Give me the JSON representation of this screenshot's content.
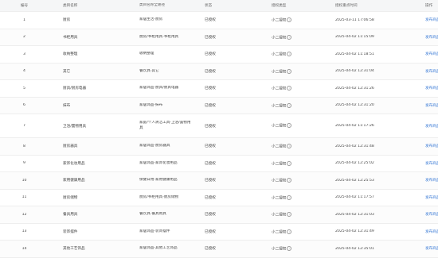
{
  "table": {
    "headers": {
      "no": "编号",
      "name": "类目名称",
      "path": "类目名称全路径",
      "status": "状态",
      "type": "授权类型",
      "time": "授权重点时间",
      "op": "操作"
    },
    "rows": [
      {
        "no": "1",
        "name": "厨房",
        "path": "家居生活-厨房",
        "status": "已授权",
        "type": "小二授权",
        "time": "2025-03-11 17:06:58",
        "op": "发布商品"
      },
      {
        "no": "2",
        "name": "书柜用具",
        "path": "厨房/书柜用具-书柜用具",
        "status": "已授权",
        "type": "小二授权",
        "time": "2025-04-02 11:15:09",
        "op": "发布商品"
      },
      {
        "no": "3",
        "name": "收纳整理",
        "path": "收纳整理",
        "status": "已授权",
        "type": "小二授权",
        "time": "2025-04-02 11:18:51",
        "op": "发布商品"
      },
      {
        "no": "4",
        "name": "其它",
        "path": "餐饮具-其它",
        "status": "已授权",
        "type": "小二授权",
        "time": "2025-04-02 12:31:04",
        "op": "发布商品"
      },
      {
        "no": "5",
        "name": "厨具/厨房电器",
        "path": "家居饰品-厨具/厨具电器",
        "status": "已授权",
        "type": "小二授权",
        "time": "2025-04-02 12:31:26",
        "op": "发布商品"
      },
      {
        "no": "6",
        "name": "抹布",
        "path": "家居饰品-抹布",
        "status": "已授权",
        "type": "小二授权",
        "time": "2025-04-02 12:31:20",
        "op": "发布商品"
      },
      {
        "no": "7",
        "name": "卫浴/置物用具",
        "path": "家庭/个人清洁工具-卫浴/置物用具",
        "status": "已授权",
        "type": "小二授权",
        "time": "2025-04-02 11:17:26",
        "op": "发布商品",
        "tall": true
      },
      {
        "no": "8",
        "name": "厨房器具",
        "path": "家居饰品-厨房器具",
        "status": "已授权",
        "type": "小二授权",
        "time": "2025-04-02 12:31:48",
        "op": "发布商品"
      },
      {
        "no": "9",
        "name": "家饰化妆用品",
        "path": "家居饰品-家饰化妆用品",
        "status": "已授权",
        "type": "小二授权",
        "time": "2025-04-02 12:25:02",
        "op": "发布商品"
      },
      {
        "no": "10",
        "name": "家用健康用品",
        "path": "保健日用-家用健康用品",
        "status": "已授权",
        "type": "小二授权",
        "time": "2025-04-02 12:25:53",
        "op": "发布商品"
      },
      {
        "no": "11",
        "name": "厨房储物",
        "path": "厨房/书柜用具-厨房储物",
        "status": "已授权",
        "type": "小二授权",
        "time": "2025-04-02 11:17:57",
        "op": "发布商品"
      },
      {
        "no": "12",
        "name": "餐具用具",
        "path": "餐饮具-餐具用具",
        "status": "已授权",
        "type": "小二授权",
        "time": "2025-04-02 12:31:03",
        "op": "发布商品"
      },
      {
        "no": "13",
        "name": "装饰摆件",
        "path": "家居饰品-装饰摆件",
        "status": "已授权",
        "type": "小二授权",
        "time": "2025-04-02 12:31:49",
        "op": "发布商品"
      },
      {
        "no": "14",
        "name": "其他工艺饰品",
        "path": "家居饰品-其他工艺饰品",
        "status": "已授权",
        "type": "小二授权",
        "time": "2025-04-02 12:35:01",
        "op": "发布商品"
      }
    ]
  }
}
